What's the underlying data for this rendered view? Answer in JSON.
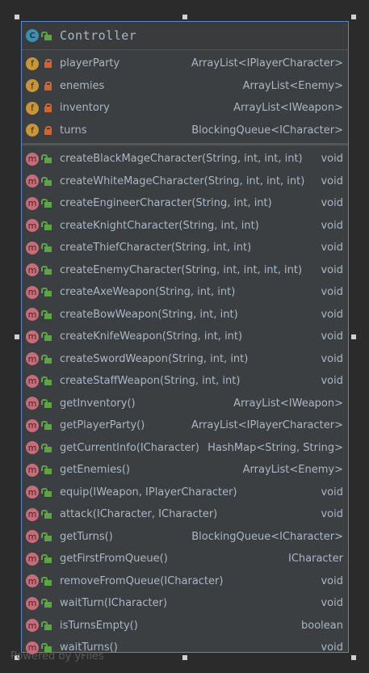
{
  "class": {
    "name": "Controller",
    "kind_icon": "C"
  },
  "fields": [
    {
      "name": "playerParty",
      "type": "ArrayList<IPlayerCharacter>"
    },
    {
      "name": "enemies",
      "type": "ArrayList<Enemy>"
    },
    {
      "name": "inventory",
      "type": "ArrayList<IWeapon>"
    },
    {
      "name": "turns",
      "type": "BlockingQueue<ICharacter>"
    }
  ],
  "methods": [
    {
      "name": "createBlackMageCharacter(String, int, int, int)",
      "type": "void"
    },
    {
      "name": "createWhiteMageCharacter(String, int, int, int)",
      "type": "void"
    },
    {
      "name": "createEngineerCharacter(String, int, int)",
      "type": "void"
    },
    {
      "name": "createKnightCharacter(String, int, int)",
      "type": "void"
    },
    {
      "name": "createThiefCharacter(String, int, int)",
      "type": "void"
    },
    {
      "name": "createEnemyCharacter(String, int, int, int, int)",
      "type": "void"
    },
    {
      "name": "createAxeWeapon(String, int, int)",
      "type": "void"
    },
    {
      "name": "createBowWeapon(String, int, int)",
      "type": "void"
    },
    {
      "name": "createKnifeWeapon(String, int, int)",
      "type": "void"
    },
    {
      "name": "createSwordWeapon(String, int, int)",
      "type": "void"
    },
    {
      "name": "createStaffWeapon(String, int, int)",
      "type": "void"
    },
    {
      "name": "getInventory()",
      "type": "ArrayList<IWeapon>"
    },
    {
      "name": "getPlayerParty()",
      "type": "ArrayList<IPlayerCharacter>"
    },
    {
      "name": "getCurrentInfo(ICharacter)",
      "type": "HashMap<String, String>"
    },
    {
      "name": "getEnemies()",
      "type": "ArrayList<Enemy>"
    },
    {
      "name": "equip(IWeapon, IPlayerCharacter)",
      "type": "void"
    },
    {
      "name": "attack(ICharacter, ICharacter)",
      "type": "void"
    },
    {
      "name": "getTurns()",
      "type": "BlockingQueue<ICharacter>"
    },
    {
      "name": "getFirstFromQueue()",
      "type": "ICharacter"
    },
    {
      "name": "removeFromQueue(ICharacter)",
      "type": "void"
    },
    {
      "name": "waitTurn(ICharacter)",
      "type": "void"
    },
    {
      "name": "isTurnsEmpty()",
      "type": "boolean"
    },
    {
      "name": "waitTurns()",
      "type": "void"
    }
  ],
  "icons": {
    "field": "f",
    "method": "m"
  },
  "footer": "Powered by yFiles"
}
